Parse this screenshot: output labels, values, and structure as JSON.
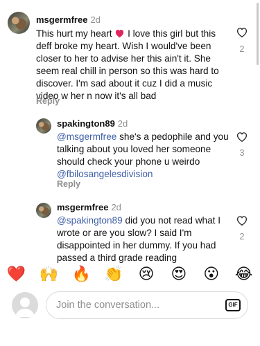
{
  "comments": [
    {
      "username": "msgermfree",
      "time": "2d",
      "text_parts": [
        "This hurt my heart ",
        " I love this girl but this deff broke my heart. Wish I would've been closer to her to advise her this ain't it. She seem real chill in person so this was hard to discover. I'm sad about it cuz I did a music video w her n now it's all bad"
      ],
      "reply_label": "Reply",
      "likes": "2"
    },
    {
      "username": "spakington89",
      "time": "2d",
      "mention1": "@msgermfree",
      "text": " she's a pedophile and you talking about you loved her someone should check your phone u weirdo ",
      "mention2": "@fbilosangelesdivision",
      "reply_label": "Reply",
      "likes": "3"
    },
    {
      "username": "msgermfree",
      "time": "2d",
      "mention1": "@spakington89",
      "text": " did you not read what I wrote or are you slow? I said I'm disappointed in her dummy. If you had passed a third grade reading",
      "likes": "2"
    }
  ],
  "emoji_bar": [
    "❤️",
    "🙌",
    "🔥",
    "👏",
    "😢",
    "😍",
    "😮",
    "😂"
  ],
  "composer": {
    "placeholder": "Join the conversation...",
    "gif_label": "GIF"
  },
  "colors": {
    "mention": "#3f5fa8",
    "secondary": "#8e8e8e",
    "heart_red": "#e0245e"
  }
}
